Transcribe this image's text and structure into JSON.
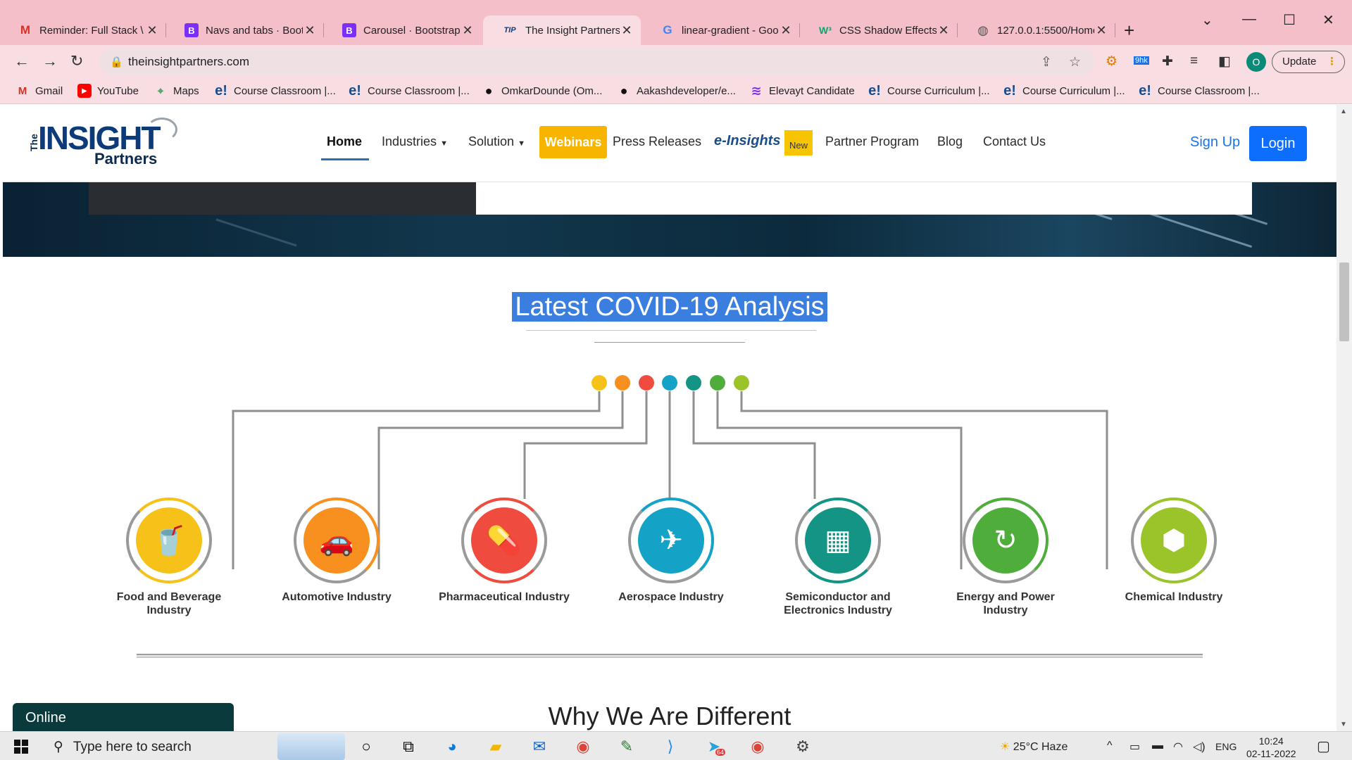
{
  "browser": {
    "tabs": [
      {
        "title": "Reminder: Full Stack \\",
        "favicon": "gmail-icon",
        "active": false
      },
      {
        "title": "Navs and tabs · Boots",
        "favicon": "bootstrap-icon",
        "active": false
      },
      {
        "title": "Carousel · Bootstrap \\",
        "favicon": "bootstrap-icon",
        "active": false
      },
      {
        "title": "The Insight Partners -",
        "favicon": "tip-icon",
        "active": true
      },
      {
        "title": "linear-gradient - Goo",
        "favicon": "google-icon",
        "active": false
      },
      {
        "title": "CSS Shadow Effects",
        "favicon": "w3schools-icon",
        "active": false
      },
      {
        "title": "127.0.0.1:5500/Home",
        "favicon": "globe-icon",
        "active": false
      }
    ],
    "tab_favicon_text": {
      "bootstrap": "B",
      "tip": "TIP",
      "gmail": "M",
      "google": "G",
      "w3": "W³"
    },
    "url": "theinsightpartners.com",
    "profile_initial": "O",
    "update_label": "Update",
    "extension_badge": "9hk",
    "bookmarks": [
      {
        "label": "Gmail",
        "icon": "gmail-icon"
      },
      {
        "label": "YouTube",
        "icon": "youtube-icon"
      },
      {
        "label": "Maps",
        "icon": "maps-icon"
      },
      {
        "label": "Course Classroom |...",
        "icon": "e-icon"
      },
      {
        "label": "Course Classroom |...",
        "icon": "e-icon"
      },
      {
        "label": "OmkarDounde (Om...",
        "icon": "github-icon"
      },
      {
        "label": "Aakashdeveloper/e...",
        "icon": "github-icon"
      },
      {
        "label": "Elevayt Candidate",
        "icon": "elevayt-icon"
      },
      {
        "label": "Course Curriculum |...",
        "icon": "e-icon"
      },
      {
        "label": "Course Curriculum |...",
        "icon": "e-icon"
      },
      {
        "label": "Course Classroom |...",
        "icon": "e-icon"
      }
    ],
    "bookmark_icon_text": {
      "e": "e!"
    }
  },
  "site": {
    "logo": {
      "the": "The",
      "insight": "INSIGHT",
      "partners": "Partners"
    },
    "nav": {
      "home": "Home",
      "industries": "Industries",
      "solution": "Solution",
      "webinars": "Webinars",
      "press": "Press Releases",
      "einsights": "e-Insights",
      "new_badge": "New",
      "partner": "Partner Program",
      "blog": "Blog",
      "contact": "Contact Us",
      "signup": "Sign Up",
      "login": "Login"
    },
    "section_title": "Latest COVID-19 Analysis",
    "industries": [
      {
        "label": "Food and Beverage Industry",
        "color": "#f6c21a",
        "icon": "food-beverage-icon"
      },
      {
        "label": "Automotive Industry",
        "color": "#f7901e",
        "icon": "car-shield-icon"
      },
      {
        "label": "Pharmaceutical Industry",
        "color": "#ef4b3f",
        "icon": "pills-icon"
      },
      {
        "label": "Aerospace Industry",
        "color": "#14a3c7",
        "icon": "airplane-icon"
      },
      {
        "label": "Semiconductor and Electronics Industry",
        "color": "#149485",
        "icon": "chip-icon"
      },
      {
        "label": "Energy and Power Industry",
        "color": "#4fad3c",
        "icon": "energy-icon"
      },
      {
        "label": "Chemical Industry",
        "color": "#9bc42b",
        "icon": "chemical-icon"
      }
    ],
    "online_label": "Online",
    "why_title": "Why We Are Different"
  },
  "taskbar": {
    "search_placeholder": "Type here to search",
    "weather": "25°C  Haze",
    "language": "ENG",
    "time": "10:24",
    "date": "02-11-2022",
    "badge_count": "64"
  }
}
